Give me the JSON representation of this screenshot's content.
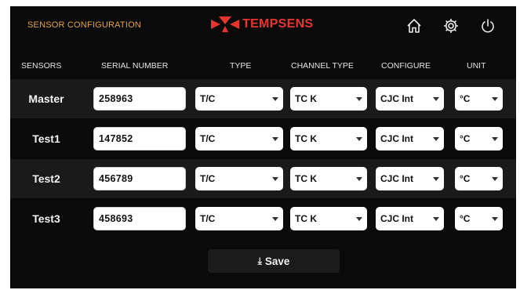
{
  "header": {
    "title": "SENSOR CONFIGURATION",
    "logo_text": "TEMPSENS",
    "icons": [
      "home-icon",
      "gear-icon",
      "power-icon"
    ]
  },
  "columns": {
    "sensors": "SENSORS",
    "serial": "SERIAL NUMBER",
    "type": "TYPE",
    "channel_type": "CHANNEL TYPE",
    "configure": "CONFIGURE",
    "unit": "UNIT"
  },
  "rows": [
    {
      "label": "Master",
      "serial": "258963",
      "type": "T/C",
      "channel_type": "TC K",
      "configure": "CJC Int",
      "unit": "°C"
    },
    {
      "label": "Test1",
      "serial": "147852",
      "type": "T/C",
      "channel_type": "TC K",
      "configure": "CJC Int",
      "unit": "°C"
    },
    {
      "label": "Test2",
      "serial": "456789",
      "type": "T/C",
      "channel_type": "TC K",
      "configure": "CJC Int",
      "unit": "°C"
    },
    {
      "label": "Test3",
      "serial": "458693",
      "type": "T/C",
      "channel_type": "TC K",
      "configure": "CJC Int",
      "unit": "°C"
    }
  ],
  "save": {
    "icon": "download-icon",
    "label": "Save"
  },
  "colors": {
    "header_title": "#e6a43a",
    "brand": "#e8352b",
    "background": "#0a0a0a",
    "row_shade": "#1a1a1a"
  }
}
